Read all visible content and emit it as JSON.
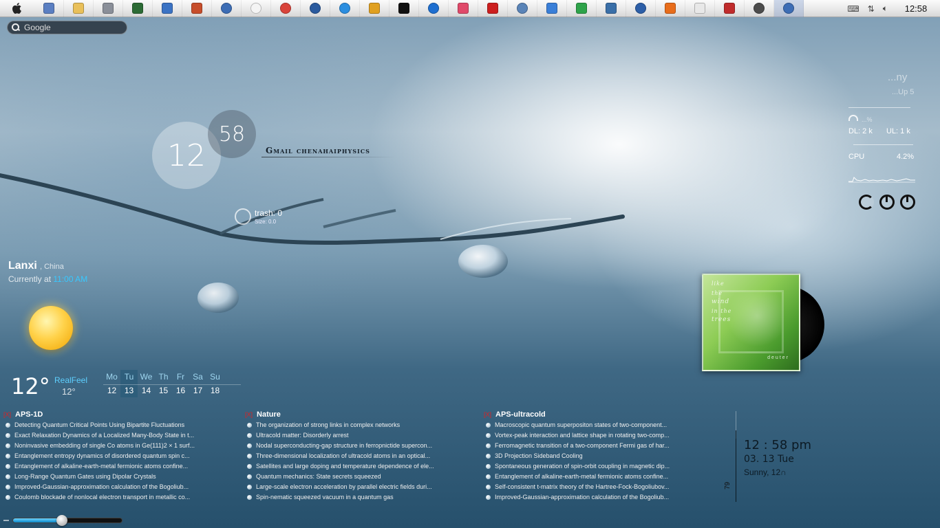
{
  "taskbar": {
    "apple_icon": "apple-logo-icon",
    "apps": [
      {
        "name": "documents",
        "color": "#5b7fc2",
        "round": false
      },
      {
        "name": "folder",
        "color": "#e9c05a",
        "round": false
      },
      {
        "name": "system-info",
        "color": "#8a8f99",
        "round": false
      },
      {
        "name": "task-manager",
        "color": "#2c6b35",
        "round": false
      },
      {
        "name": "remote-desktop",
        "color": "#3b73c4",
        "round": false
      },
      {
        "name": "paint-app",
        "color": "#c74e2b",
        "round": false
      },
      {
        "name": "itunes-1",
        "color": "#3d6db5",
        "round": true
      },
      {
        "name": "chat",
        "color": "#f4f4f4",
        "round": true
      },
      {
        "name": "chrome",
        "color": "#d9443b",
        "round": true
      },
      {
        "name": "globe",
        "color": "#2a5a9e",
        "round": true
      },
      {
        "name": "internet-explorer",
        "color": "#2b8ee0",
        "round": true
      },
      {
        "name": "tools",
        "color": "#e0a020",
        "round": false
      },
      {
        "name": "dbs",
        "color": "#111111",
        "round": false
      },
      {
        "name": "back-app",
        "color": "#1e6fd0",
        "round": true
      },
      {
        "name": "colorful-app",
        "color": "#e04a6a",
        "round": false
      },
      {
        "name": "acrobat",
        "color": "#cc1f1f",
        "round": false
      },
      {
        "name": "settings-app",
        "color": "#5a84b8",
        "round": true
      },
      {
        "name": "arrow-app",
        "color": "#3a7fd8",
        "round": false
      },
      {
        "name": "graph-app",
        "color": "#2ea34a",
        "round": false
      },
      {
        "name": "python",
        "color": "#3a6fa8",
        "round": false
      },
      {
        "name": "search-app",
        "color": "#2d5fa8",
        "round": true
      },
      {
        "name": "matlab",
        "color": "#e86d1b",
        "round": false
      },
      {
        "name": "drop",
        "color": "#e8e8e8",
        "round": false
      },
      {
        "name": "x-app",
        "color": "#c02c2c",
        "round": false
      },
      {
        "name": "steam",
        "color": "#4c4c4c",
        "round": true
      },
      {
        "name": "itunes-2",
        "color": "#3d6db5",
        "round": true
      }
    ],
    "clock": "12:58"
  },
  "search": {
    "placeholder": "Google"
  },
  "clock_widget": {
    "hour": "12",
    "minute": "58",
    "gmail_label": "Gmail chenahaiphysics"
  },
  "trash": {
    "label": "trash: 0",
    "size": "Size: 0.0"
  },
  "system": {
    "title": "...ny",
    "subtitle": "...Up 5",
    "wifi_pct": "...%",
    "dl": "DL: 2 k",
    "ul": "UL: 1 k",
    "cpu_label": "CPU",
    "cpu_value": "4.2%"
  },
  "weather": {
    "city": "Lanxi",
    "country": ", China",
    "currently_prefix": "Currently at",
    "currently_time": "11:00 AM",
    "temp": "12°",
    "realfeel_label": "RealFeel",
    "realfeel_value": "12°"
  },
  "week": {
    "days": [
      "Mo",
      "Tu",
      "We",
      "Th",
      "Fr",
      "Sa",
      "Su"
    ],
    "dates": [
      "12",
      "13",
      "14",
      "15",
      "16",
      "17",
      "18"
    ],
    "today_index": 1
  },
  "album": {
    "title_lines": [
      "like",
      "the",
      "wind",
      "in the",
      "trees"
    ],
    "artist": "deuter"
  },
  "feeds": [
    {
      "close": "[X]",
      "title": "APS-1D",
      "items": [
        "Detecting Quantum Critical Points Using Bipartite Fluctuations",
        "Exact Relaxation Dynamics of a Localized Many-Body State in t...",
        "Noninvasive embedding of single Co atoms in Ge(111)2 × 1 surf...",
        "Entanglement entropy dynamics of disordered quantum spin c...",
        "Entanglement of alkaline-earth-metal fermionic atoms confine...",
        "Long-Range Quantum Gates using Dipolar Crystals",
        "Improved-Gaussian-approximation calculation of the Bogoliub...",
        "Coulomb blockade of nonlocal electron transport in metallic co..."
      ]
    },
    {
      "close": "[X]",
      "title": "Nature",
      "items": [
        "The organization of strong links in complex networks",
        "Ultracold matter: Disorderly arrest",
        "Nodal superconducting-gap structure in ferropnictide supercon...",
        "Three-dimensional localization of ultracold atoms in an optical...",
        "Satellites and large doping and temperature dependence of ele...",
        "Quantum mechanics: State secrets squeezed",
        "Large-scale electron acceleration by parallel electric fields duri...",
        "Spin-nematic squeezed vacuum in a quantum gas"
      ]
    },
    {
      "close": "[X]",
      "title": "APS-ultracold",
      "items": [
        "Macroscopic quantum superpositon states of two-component...",
        "Vortex-peak interaction and lattice shape in rotating two-comp...",
        "Ferromagnetic transition of a two-component Fermi gas of har...",
        "3D Projection Sideband Cooling",
        "Spontaneous generation of spin-orbit coupling in magnetic dip...",
        "Entanglement of alkaline-earth-metal fermionic atoms confine...",
        "Self-consistent t-matrix theory of the Hartree-Fock-Bogoliubov...",
        "Improved-Gaussian-approximation calculation of the Bogoliub..."
      ]
    }
  ],
  "datetime": {
    "time": "12 : 58 pm",
    "date": "03. 13 Tue",
    "weather": "Sunny, 12∩",
    "side_number": "79"
  },
  "volume": {
    "level": 0.45
  }
}
